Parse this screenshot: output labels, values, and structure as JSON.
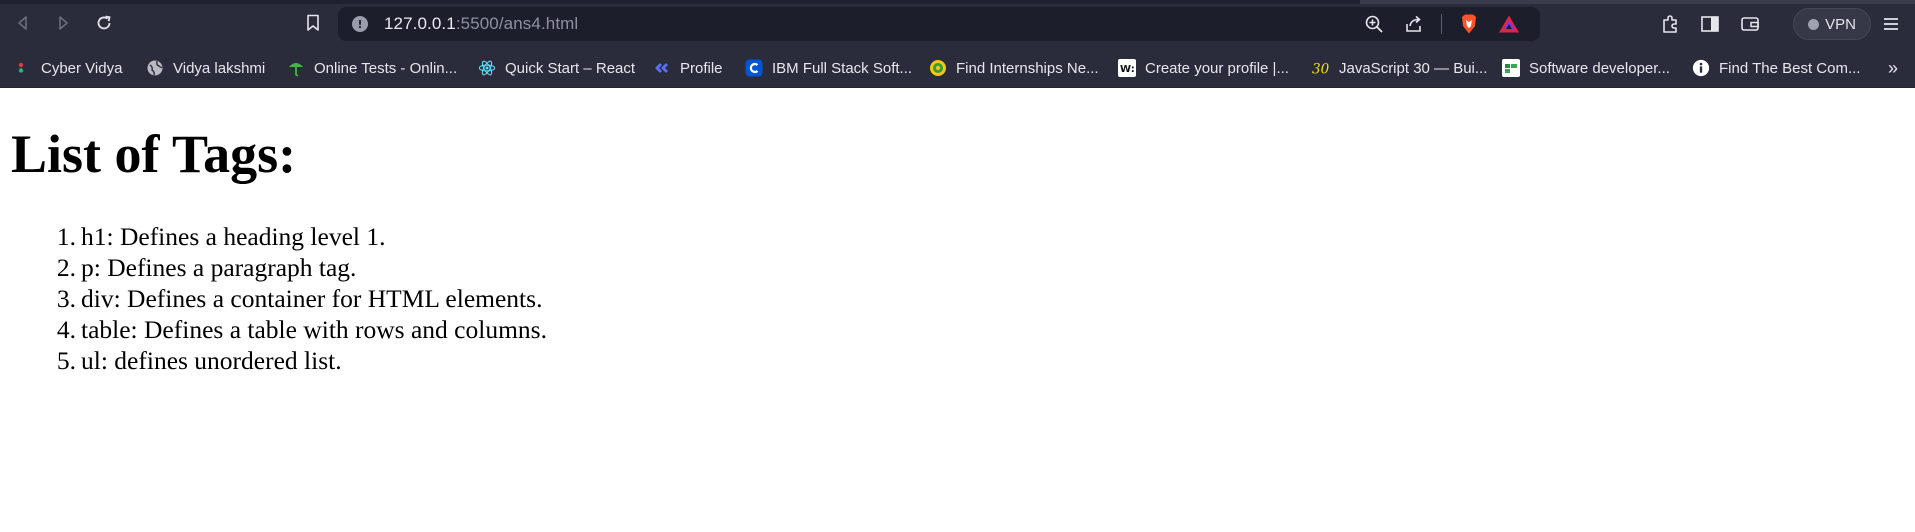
{
  "browser": {
    "url_host": "127.0.0.1",
    "url_rest": ":5500/ans4.html",
    "vpn_label": "VPN",
    "icons": {
      "back": "back-arrow-icon",
      "forward": "forward-arrow-icon",
      "reload": "reload-icon",
      "bookmark": "bookmark-icon",
      "zoom": "zoom-icon",
      "share": "share-icon",
      "brave": "brave-shields-icon",
      "rewards": "brave-rewards-icon",
      "extensions": "extensions-icon",
      "sidebar": "sidebar-icon",
      "wallet": "wallet-icon",
      "menu": "hamburger-menu-icon"
    }
  },
  "bookmarks": [
    {
      "label": "Cyber Vidya",
      "icon": "cybervidya-icon"
    },
    {
      "label": "Vidya lakshmi",
      "icon": "globe-icon"
    },
    {
      "label": "Online Tests - Onlin...",
      "icon": "tests-icon"
    },
    {
      "label": "Quick Start – React",
      "icon": "react-icon"
    },
    {
      "label": "Profile",
      "icon": "profile-icon"
    },
    {
      "label": "IBM Full Stack Soft...",
      "icon": "coursera-icon"
    },
    {
      "label": "Find Internships Ne...",
      "icon": "internshala-icon"
    },
    {
      "label": "Create your profile |...",
      "icon": "w-icon"
    },
    {
      "label": "JavaScript 30 — Bui...",
      "icon": "js30-icon"
    },
    {
      "label": "Software developer...",
      "icon": "sheet-icon"
    },
    {
      "label": "Find The Best Com...",
      "icon": "info-icon"
    }
  ],
  "bookmarks_overflow": "»",
  "page": {
    "heading": "List of Tags:",
    "items": [
      {
        "num": "1.",
        "text": "h1: Defines a heading level 1."
      },
      {
        "num": "2.",
        "text": "p: Defines a paragraph tag."
      },
      {
        "num": "3.",
        "text": "div: Defines a container for HTML elements."
      },
      {
        "num": "4.",
        "text": "table: Defines a table with rows and columns."
      },
      {
        "num": "5.",
        "text": "ul: defines unordered list."
      }
    ]
  },
  "colors": {
    "chrome_bg": "#2b2c3b",
    "urlbar_bg": "#1d1e2b",
    "brave_orange": "#fb542b",
    "page_bg": "#ffffff"
  }
}
